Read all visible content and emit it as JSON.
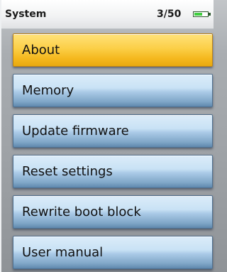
{
  "status": {
    "title": "System",
    "count": "3/50",
    "battery_level": 0.6,
    "battery_icon": "battery-icon"
  },
  "menu": {
    "items": [
      {
        "label": "About",
        "selected": true
      },
      {
        "label": "Memory",
        "selected": false
      },
      {
        "label": "Update firmware",
        "selected": false
      },
      {
        "label": "Reset settings",
        "selected": false
      },
      {
        "label": "Rewrite boot block",
        "selected": false
      },
      {
        "label": "User manual",
        "selected": false
      }
    ]
  },
  "colors": {
    "selected": "#fbcf47",
    "item": "#a9c9e6",
    "battery": "#3fcf3f"
  }
}
